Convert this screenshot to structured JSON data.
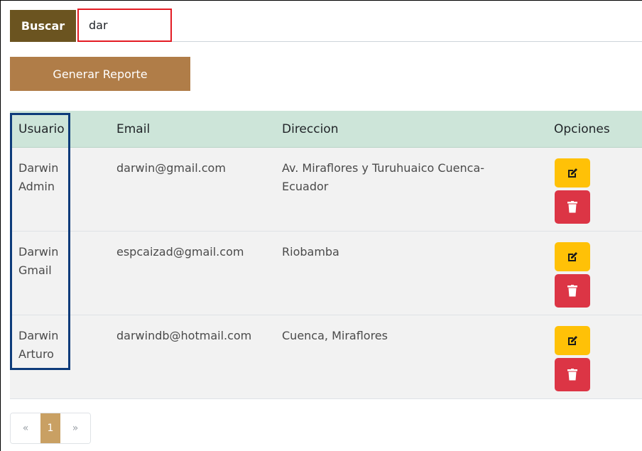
{
  "search": {
    "button_label": "Buscar",
    "value": "dar"
  },
  "report_button": "Generar Reporte",
  "table": {
    "headers": [
      "Usuario",
      "Email",
      "Direccion",
      "Opciones"
    ],
    "rows": [
      {
        "usuario": "Darwin Admin",
        "email": "darwin@gmail.com",
        "direccion": "Av. Miraflores y Turuhuaico Cuenca-Ecuador"
      },
      {
        "usuario": "Darwin Gmail",
        "email": "espcaizad@gmail.com",
        "direccion": "Riobamba"
      },
      {
        "usuario": "Darwin Arturo",
        "email": "darwindb@hotmail.com",
        "direccion": "Cuenca, Miraflores"
      }
    ]
  },
  "pagination": {
    "prev": "«",
    "current": "1",
    "next": "»"
  },
  "colors": {
    "search_button": "#6b5420",
    "report_button": "#b07d48",
    "header_bg": "#cde5d9",
    "edit": "#ffc107",
    "delete": "#dc3545",
    "active_page": "#c9a063"
  },
  "icons": {
    "edit": "edit-icon",
    "delete": "trash-icon"
  }
}
